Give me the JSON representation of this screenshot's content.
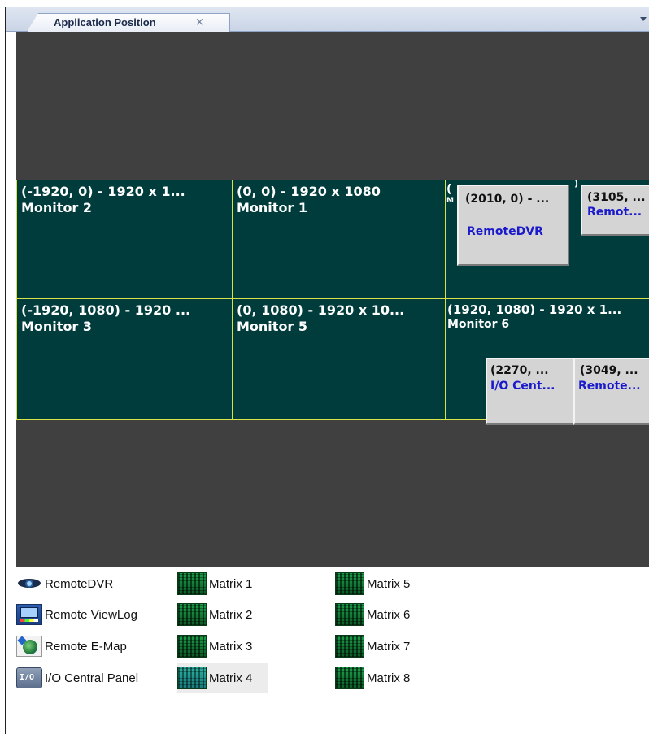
{
  "tab": {
    "title": "Application Position",
    "close_glyph": "×",
    "close_icon": "close-icon",
    "overflow_icon": "chevron-down-icon"
  },
  "monitors": [
    {
      "resolution": "(-1920, 0) - 1920 x 1...",
      "name": "Monitor 2"
    },
    {
      "resolution": "(0, 0) - 1920 x 1080",
      "name": "Monitor 1"
    },
    {
      "resolution": "(-1920, 1080) - 1920 ...",
      "name": "Monitor 3"
    },
    {
      "resolution": "(0, 1080) - 1920 x 10...",
      "name": "Monitor 5"
    },
    {
      "resolution": "(1920, 1080) - 1920 x 1...",
      "name": "Monitor 6"
    }
  ],
  "windows": [
    {
      "position": "(2010, 0) - ...",
      "name": "RemoteDVR"
    },
    {
      "position": "(3105, ...",
      "name": "Remot..."
    },
    {
      "position": "(2270, ...",
      "name": "I/O Cent..."
    },
    {
      "position": "(3049, ...",
      "name": "Remote..."
    }
  ],
  "hidden_monitor_glyph": "(",
  "hidden_monitor_glyph_end": ")",
  "hidden_monitor_glyph_mid": "M",
  "applications": [
    {
      "label": "RemoteDVR",
      "icon": "eye-icon"
    },
    {
      "label": "Remote ViewLog",
      "icon": "viewlog-icon"
    },
    {
      "label": "Remote E-Map",
      "icon": "emap-icon"
    },
    {
      "label": "I/O Central Panel",
      "icon": "io-panel-icon"
    }
  ],
  "matrices": [
    {
      "label": "Matrix 1",
      "icon": "matrix-icon",
      "selected": false
    },
    {
      "label": "Matrix 2",
      "icon": "matrix-icon",
      "selected": false
    },
    {
      "label": "Matrix 3",
      "icon": "matrix-icon",
      "selected": false
    },
    {
      "label": "Matrix 4",
      "icon": "matrix-icon",
      "selected": true
    },
    {
      "label": "Matrix 5",
      "icon": "matrix-icon",
      "selected": false
    },
    {
      "label": "Matrix 6",
      "icon": "matrix-icon",
      "selected": false
    },
    {
      "label": "Matrix 7",
      "icon": "matrix-icon",
      "selected": false
    },
    {
      "label": "Matrix 8",
      "icon": "matrix-icon",
      "selected": false
    }
  ],
  "colors": {
    "canvas": "#404040",
    "monitor_fill": "#003c3c",
    "monitor_border": "#d8e24a",
    "window_fill": "#d4d4d4",
    "window_name": "#1a1acc"
  }
}
